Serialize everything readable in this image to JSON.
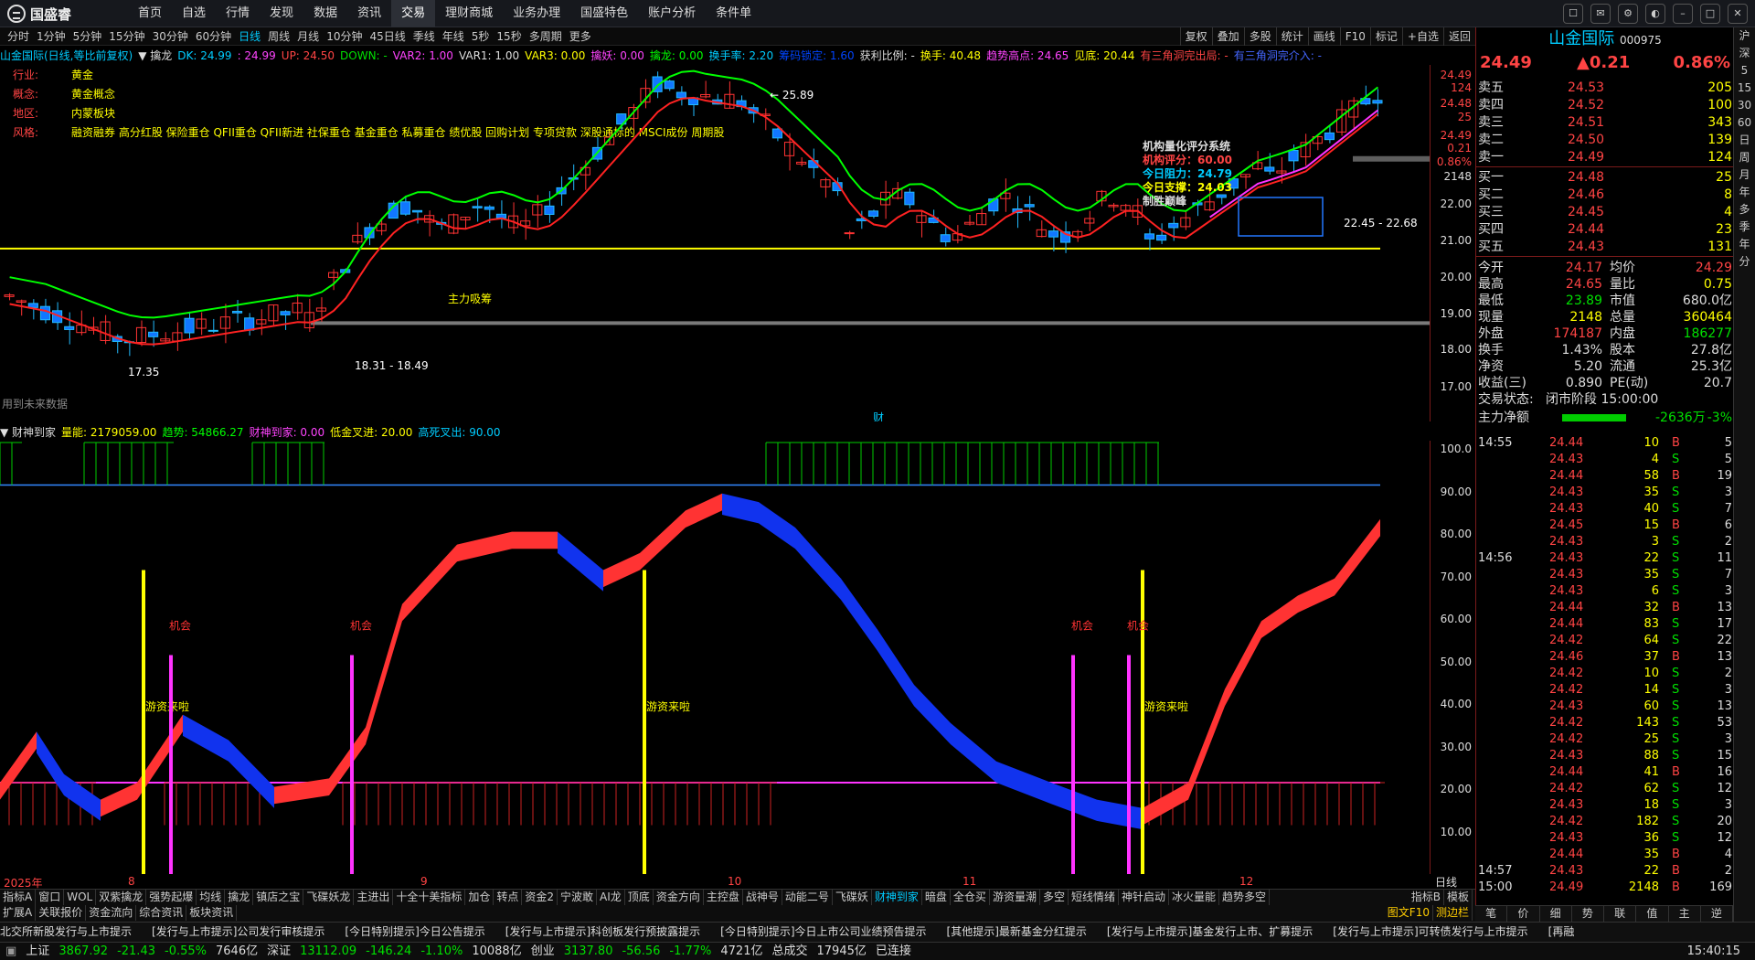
{
  "app": {
    "logo": "国盛睿",
    "menu": [
      "首页",
      "自选",
      "行情",
      "发现",
      "数据",
      "资讯",
      "交易",
      "理财商城",
      "业务办理",
      "国盛特色",
      "账户分析",
      "条件单"
    ],
    "active_menu": "交易"
  },
  "periods": [
    "分时",
    "1分钟",
    "5分钟",
    "15分钟",
    "30分钟",
    "60分钟",
    "日线",
    "周线",
    "月线",
    "10分钟",
    "45日线",
    "季线",
    "年线",
    "5秒",
    "15秒",
    "多周期",
    "更多"
  ],
  "active_period": "日线",
  "tools": [
    "复权",
    "叠加",
    "多股",
    "统计",
    "画线",
    "F10",
    "标记",
    "+自选",
    "返回"
  ],
  "main_indicator": [
    {
      "t": "山金国际(日线,等比前复权)",
      "c": "#00ccff"
    },
    {
      "t": "▼ 擒龙",
      "c": "#dddddd"
    },
    {
      "t": "DK: 24.99",
      "c": "#00ccff"
    },
    {
      "t": ": 24.99",
      "c": "#ff44ff"
    },
    {
      "t": "UP: 24.50",
      "c": "#ff4444"
    },
    {
      "t": "DOWN: -",
      "c": "#00e000"
    },
    {
      "t": "VAR2: 1.00",
      "c": "#ff44ff"
    },
    {
      "t": "VAR1: 1.00",
      "c": "#dddddd"
    },
    {
      "t": "VAR3: 0.00",
      "c": "#ffff00"
    },
    {
      "t": "擒妖: 0.00",
      "c": "#ff44ff"
    },
    {
      "t": "擒龙: 0.00",
      "c": "#00ff00"
    },
    {
      "t": "换手率: 2.20",
      "c": "#00ccff"
    },
    {
      "t": "筹码锁定: 1.60",
      "c": "#0044ff"
    },
    {
      "t": "获利比例: -",
      "c": "#dddddd"
    },
    {
      "t": "换手: 40.48",
      "c": "#ffff00"
    },
    {
      "t": "趋势高点: 24.65",
      "c": "#ff44ff"
    },
    {
      "t": "见底: 20.44",
      "c": "#ffff00"
    },
    {
      "t": "有三角洞完出局: -",
      "c": "#ff4444"
    },
    {
      "t": "有三角洞完介入: -",
      "c": "#4466ff"
    }
  ],
  "info": [
    {
      "k": "行业:",
      "v": "黄金"
    },
    {
      "k": "概念:",
      "v": "黄金概念"
    },
    {
      "k": "地区:",
      "v": "内蒙板块"
    },
    {
      "k": "风格:",
      "v": "融资融券 高分红股 保险重仓 QFII重仓 QFII新进 社保重仓 基金重仓 私募重仓 绩优股 回购计划 专项贷款 深股通标的 MSCI成份 周期股"
    }
  ],
  "rating": {
    "title": "机构量化评分系统",
    "rows": [
      {
        "k": "机构评分：",
        "v": "60.00",
        "c": "#ff4444"
      },
      {
        "k": "今日阻力：",
        "v": "24.79",
        "c": "#00ccff"
      },
      {
        "k": "今日支撑：",
        "v": "24.03",
        "c": "#ffff00"
      }
    ],
    "footer": "制胜巅峰"
  },
  "chart_labels": {
    "high": "25.89",
    "low_left": "17.35",
    "low_mid": "18.31 - 18.49",
    "zhuli": "主力吸筹",
    "range": "22.45 - 22.68",
    "future": "用到未来数据",
    "cai": "财"
  },
  "main_axis": [
    "24.49",
    "124",
    "24.48",
    "25",
    "24.49",
    "0.21",
    "0.86%",
    "2148",
    "22.00",
    "21.00",
    "20.00",
    "19.00",
    "18.00",
    "17.00"
  ],
  "sub_indicator": [
    {
      "t": "▼ 财神到家",
      "c": "#dddddd"
    },
    {
      "t": "量能: 2179059.00",
      "c": "#ffff00"
    },
    {
      "t": "趋势: 54866.27",
      "c": "#00ff00"
    },
    {
      "t": "财神到家: 0.00",
      "c": "#ff44ff"
    },
    {
      "t": "低金叉进: 20.00",
      "c": "#ffff00"
    },
    {
      "t": "高死叉出: 90.00",
      "c": "#00ccff"
    }
  ],
  "sub_axis": [
    "100.0",
    "90.00",
    "80.00",
    "70.00",
    "60.00",
    "50.00",
    "40.00",
    "30.00",
    "20.00",
    "10.00"
  ],
  "sub_labels": {
    "jihui": "机会",
    "youzi": "游资来啦"
  },
  "date_axis": [
    "2025年",
    "8",
    "9",
    "10",
    "11",
    "12"
  ],
  "tabs1": [
    "指标A",
    "窗口",
    "WOL",
    "双紫擒龙",
    "强势起爆",
    "均线",
    "擒龙",
    "镇店之宝",
    "飞碟妖龙",
    "主进出",
    "十全十美指标",
    "加仓",
    "转点",
    "资金2",
    "宁波敢",
    "AI龙",
    "顶底",
    "资金方向",
    "主控盘",
    "战神号",
    "动能二号",
    "飞碟妖",
    "财神到家",
    "暗盘",
    "全仓买",
    "游资量潮",
    "多空",
    "短线情绪",
    "神针启动",
    "冰火量能",
    "趋势多空"
  ],
  "active_tab1": "财神到家",
  "tabs1_right": [
    "指标B",
    "模板"
  ],
  "tabs2": [
    "扩展A",
    "关联报价",
    "资金流向",
    "综合资讯",
    "板块资讯"
  ],
  "active_tab2": "综合资讯",
  "tabs2_right": [
    "图文F10",
    "测边栏"
  ],
  "ticker": [
    "北交所新股发行与上市提示",
    "[发行与上市提示]公司发行审核提示",
    "[今日特别提示]今日公告提示",
    "[发行与上市提示]科创板发行预披露提示",
    "[今日特别提示]今日上市公司业绩预告提示",
    "[其他提示]最新基金分红提示",
    "[发行与上市提示]基金发行上市、扩募提示",
    "[发行与上市提示]可转债发行与上市提示",
    "[再融"
  ],
  "status": [
    {
      "t": "上证",
      "c": "#dddddd"
    },
    {
      "t": "3867.92",
      "c": "#00e000"
    },
    {
      "t": "-21.43",
      "c": "#00e000"
    },
    {
      "t": "-0.55%",
      "c": "#00e000"
    },
    {
      "t": "7646亿",
      "c": "#dddddd"
    },
    {
      "t": "深证",
      "c": "#dddddd"
    },
    {
      "t": "13112.09",
      "c": "#00e000"
    },
    {
      "t": "-146.24",
      "c": "#00e000"
    },
    {
      "t": "-1.10%",
      "c": "#00e000"
    },
    {
      "t": "10088亿",
      "c": "#dddddd"
    },
    {
      "t": "创业",
      "c": "#dddddd"
    },
    {
      "t": "3137.80",
      "c": "#00e000"
    },
    {
      "t": "-56.56",
      "c": "#00e000"
    },
    {
      "t": "-1.77%",
      "c": "#00e000"
    },
    {
      "t": "4721亿",
      "c": "#dddddd"
    },
    {
      "t": "总成交",
      "c": "#dddddd"
    },
    {
      "t": "17945亿",
      "c": "#dddddd"
    },
    {
      "t": "已连接",
      "c": "#dddddd"
    }
  ],
  "clock": "15:40:15",
  "stock": {
    "name": "山金国际",
    "code": "000975",
    "price": "24.49",
    "change": "▲0.21",
    "pct": "0.86%"
  },
  "asks": [
    {
      "l": "卖五",
      "p": "24.53",
      "q": "205"
    },
    {
      "l": "卖四",
      "p": "24.52",
      "q": "100"
    },
    {
      "l": "卖三",
      "p": "24.51",
      "q": "343"
    },
    {
      "l": "卖二",
      "p": "24.50",
      "q": "139"
    },
    {
      "l": "卖一",
      "p": "24.49",
      "q": "124"
    }
  ],
  "bids": [
    {
      "l": "买一",
      "p": "24.48",
      "q": "25"
    },
    {
      "l": "买二",
      "p": "24.46",
      "q": "8"
    },
    {
      "l": "买三",
      "p": "24.45",
      "q": "4"
    },
    {
      "l": "买四",
      "p": "24.44",
      "q": "23"
    },
    {
      "l": "买五",
      "p": "24.43",
      "q": "131"
    }
  ],
  "stats": [
    [
      "今开",
      "24.17",
      "#ff4444",
      "均价",
      "24.29",
      "#ff4444"
    ],
    [
      "最高",
      "24.65",
      "#ff4444",
      "量比",
      "0.75",
      "#ffff00"
    ],
    [
      "最低",
      "23.89",
      "#00e000",
      "市值",
      "680.0亿",
      "#dddddd"
    ],
    [
      "现量",
      "2148",
      "#ffff00",
      "总量",
      "360464",
      "#ffff00"
    ],
    [
      "外盘",
      "174187",
      "#ff4444",
      "内盘",
      "186277",
      "#00e000"
    ],
    [
      "换手",
      "1.43%",
      "#dddddd",
      "股本",
      "27.8亿",
      "#dddddd"
    ],
    [
      "净资",
      "5.20",
      "#dddddd",
      "流通",
      "25.3亿",
      "#dddddd"
    ],
    [
      "收益(三)",
      "0.890",
      "#dddddd",
      "PE(动)",
      "20.7",
      "#dddddd"
    ]
  ],
  "trade_state": {
    "k": "交易状态:",
    "v": "闭市阶段 15:00:00"
  },
  "netflow": {
    "k": "主力净额",
    "v": "-2636万",
    "pct": "-3%"
  },
  "ticks": [
    {
      "t": "14:55",
      "p": "24.44",
      "v": "10",
      "d": "B",
      "n": "5"
    },
    {
      "t": "",
      "p": "24.43",
      "v": "4",
      "d": "S",
      "n": "5"
    },
    {
      "t": "",
      "p": "24.44",
      "v": "58",
      "d": "B",
      "n": "19"
    },
    {
      "t": "",
      "p": "24.43",
      "v": "35",
      "d": "S",
      "n": "3"
    },
    {
      "t": "",
      "p": "24.43",
      "v": "40",
      "d": "S",
      "n": "7"
    },
    {
      "t": "",
      "p": "24.45",
      "v": "15",
      "d": "B",
      "n": "6"
    },
    {
      "t": "",
      "p": "24.43",
      "v": "3",
      "d": "S",
      "n": "2"
    },
    {
      "t": "14:56",
      "p": "24.43",
      "v": "22",
      "d": "S",
      "n": "11"
    },
    {
      "t": "",
      "p": "24.43",
      "v": "35",
      "d": "S",
      "n": "7"
    },
    {
      "t": "",
      "p": "24.43",
      "v": "6",
      "d": "S",
      "n": "3"
    },
    {
      "t": "",
      "p": "24.44",
      "v": "32",
      "d": "B",
      "n": "13"
    },
    {
      "t": "",
      "p": "24.44",
      "v": "83",
      "d": "S",
      "n": "17"
    },
    {
      "t": "",
      "p": "24.42",
      "v": "64",
      "d": "S",
      "n": "22"
    },
    {
      "t": "",
      "p": "24.46",
      "v": "37",
      "d": "B",
      "n": "13"
    },
    {
      "t": "",
      "p": "24.42",
      "v": "10",
      "d": "S",
      "n": "2"
    },
    {
      "t": "",
      "p": "24.42",
      "v": "14",
      "d": "S",
      "n": "3"
    },
    {
      "t": "",
      "p": "24.43",
      "v": "60",
      "d": "S",
      "n": "13"
    },
    {
      "t": "",
      "p": "24.42",
      "v": "143",
      "d": "S",
      "n": "53"
    },
    {
      "t": "",
      "p": "24.42",
      "v": "25",
      "d": "S",
      "n": "3"
    },
    {
      "t": "",
      "p": "24.43",
      "v": "88",
      "d": "S",
      "n": "15"
    },
    {
      "t": "",
      "p": "24.44",
      "v": "41",
      "d": "B",
      "n": "16"
    },
    {
      "t": "",
      "p": "24.42",
      "v": "62",
      "d": "S",
      "n": "12"
    },
    {
      "t": "",
      "p": "24.43",
      "v": "18",
      "d": "S",
      "n": "3"
    },
    {
      "t": "",
      "p": "24.42",
      "v": "182",
      "d": "S",
      "n": "20"
    },
    {
      "t": "",
      "p": "24.43",
      "v": "36",
      "d": "S",
      "n": "12"
    },
    {
      "t": "",
      "p": "24.44",
      "v": "35",
      "d": "B",
      "n": "4"
    },
    {
      "t": "14:57",
      "p": "24.43",
      "v": "22",
      "d": "B",
      "n": "2"
    },
    {
      "t": "15:00",
      "p": "24.49",
      "v": "2148",
      "d": "B",
      "n": "169"
    }
  ],
  "rbottomtabs": [
    "笔",
    "价",
    "细",
    "势",
    "联",
    "值",
    "主",
    "逆"
  ],
  "rside": [
    "沪深",
    "5",
    "15",
    "30",
    "60",
    "日",
    "周",
    "月",
    "年",
    "多",
    "季",
    "年",
    "分"
  ]
}
